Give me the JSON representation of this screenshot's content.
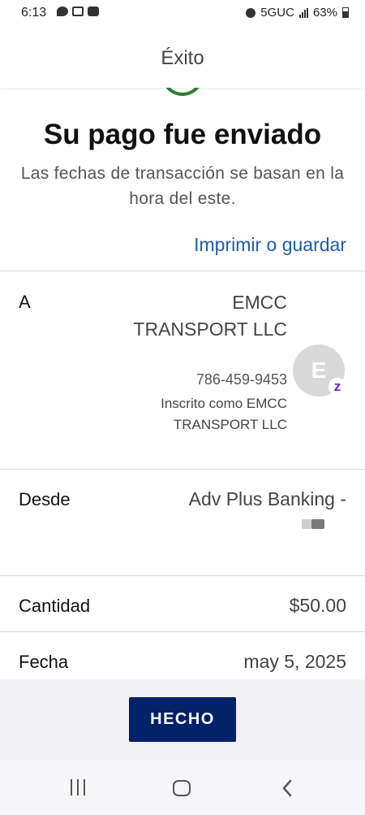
{
  "status_bar": {
    "time": "6:13",
    "network": "5GUC",
    "battery": "63%",
    "icons": [
      "chat-icon",
      "gmail-icon",
      "youtube-icon",
      "alarm-icon",
      "signal-icon",
      "battery-icon"
    ]
  },
  "header": {
    "title": "Éxito"
  },
  "confirmation": {
    "heading": "Su pago fue enviado",
    "subtext": "Las fechas de transacción se basan en la hora del este.",
    "print_link": "Imprimir o guardar"
  },
  "details": {
    "to": {
      "label": "A",
      "name": "EMCC TRANSPORT LLC",
      "phone": "786-459-9453",
      "enrolled_as": "Inscrito como EMCC TRANSPORT LLC",
      "avatar_initial": "E",
      "badge": "z"
    },
    "from": {
      "label": "Desde",
      "account": "Adv Plus Banking -"
    },
    "amount": {
      "label": "Cantidad",
      "value": "$50.00"
    },
    "date": {
      "label": "Fecha",
      "value": "may 5, 2025"
    }
  },
  "footer": {
    "done_label": "HECHO"
  },
  "colors": {
    "link": "#1c5eab",
    "primary_button": "#012169",
    "success": "#2e7d32",
    "zelle": "#6d1ed4"
  }
}
